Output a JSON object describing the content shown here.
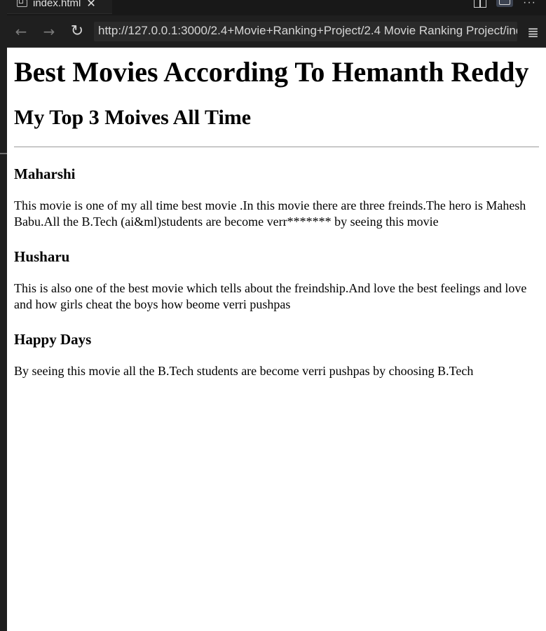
{
  "editor": {
    "tab": {
      "label": "index.html",
      "close": "✕"
    },
    "actions": {
      "more": "···"
    }
  },
  "browser": {
    "back": "←",
    "forward": "→",
    "reload": "↻",
    "url": "http://127.0.0.1:3000/2.4+Movie+Ranking+Project/2.4 Movie Ranking Project/ind",
    "menu": "≣"
  },
  "page": {
    "title": "Best Movies According To Hemanth Reddy",
    "subtitle": "My Top 3 Moives All Time",
    "movies": [
      {
        "name": "Maharshi",
        "description": "This movie is one of my all time best movie .In this movie there are three freinds.The hero is Mahesh Babu.All the B.Tech (ai&ml)students are become verr******* by seeing this movie"
      },
      {
        "name": "Husharu",
        "description": "This is also one of the best movie which tells about the freindship.And love the best feelings and love and how girls cheat the boys how beome verri pushpas"
      },
      {
        "name": "Happy Days",
        "description": "By seeing this movie all the B.Tech students are become verri pushpas by choosing B.Tech"
      }
    ]
  }
}
